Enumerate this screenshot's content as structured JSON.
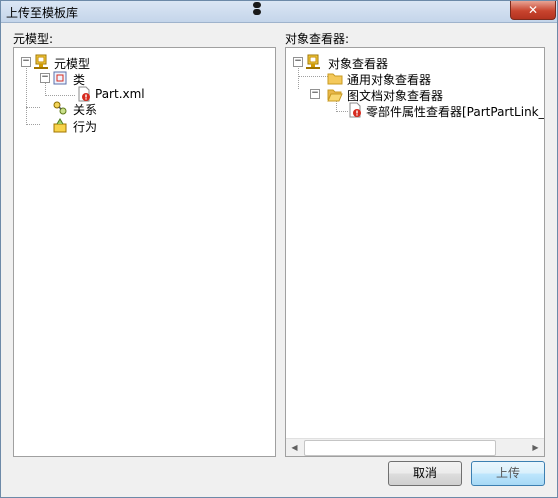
{
  "window": {
    "title": "上传至模板库",
    "close_label": "✕"
  },
  "left": {
    "label": "元模型:",
    "tree": [
      {
        "label": "元模型",
        "expander": "−",
        "icon": "meta-model-icon"
      },
      {
        "label": "类",
        "expander": "−",
        "icon": "class-icon"
      },
      {
        "label": "Part.xml",
        "icon": "xml-file-warning-icon"
      },
      {
        "label": "关系",
        "icon": "relation-icon"
      },
      {
        "label": "行为",
        "icon": "behavior-icon"
      }
    ]
  },
  "right": {
    "label": "对象查看器:",
    "tree": [
      {
        "label": "对象查看器",
        "expander": "−",
        "icon": "object-viewer-icon"
      },
      {
        "label": "通用对象查看器",
        "icon": "folder-icon"
      },
      {
        "label": "图文档对象查看器",
        "expander": "−",
        "icon": "folder-open-icon"
      },
      {
        "label": "零部件属性查看器[PartPartLink_Vie",
        "icon": "file-warning-icon"
      }
    ],
    "scroll_left": "◀",
    "scroll_right": "▶"
  },
  "buttons": {
    "cancel": "取消",
    "upload": "上传"
  },
  "colors": {
    "titlebar": "#c4d5ea",
    "close": "#c8442e",
    "folder": "#f4c95b",
    "warning": "#d62b1f"
  }
}
